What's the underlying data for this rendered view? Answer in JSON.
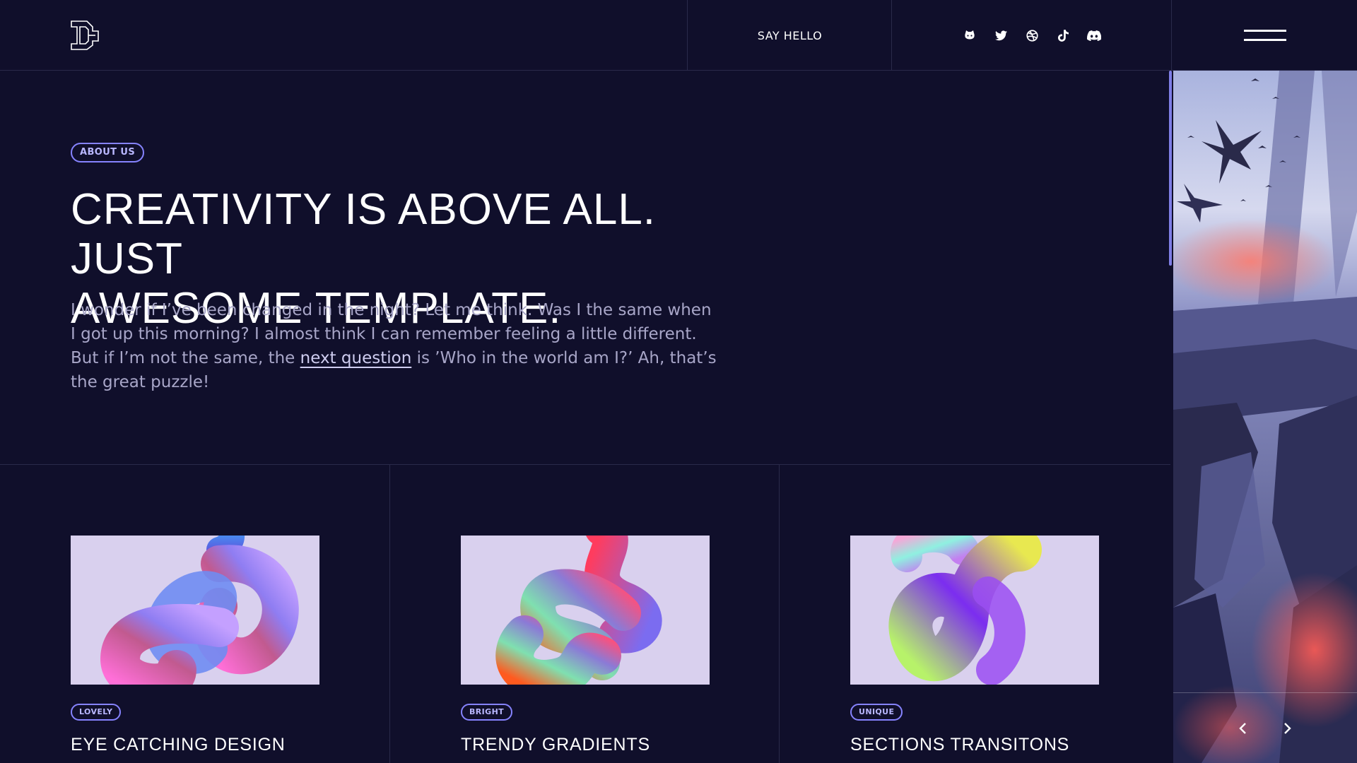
{
  "header": {
    "logo_icon": "logo-icon",
    "say_hello_label": "SAY HELLO",
    "socials": [
      "github-icon",
      "twitter-icon",
      "dribbble-icon",
      "tiktok-icon",
      "discord-icon"
    ],
    "menu_icon": "hamburger-menu-icon"
  },
  "hero": {
    "badge": "ABOUT US",
    "title_line1": "CREATIVITY IS ABOVE ALL. JUST",
    "title_line2": "AWESOME TEMPLATE.",
    "text_before_link": "I wonder if I’ve been changed in the night? Let me think. Was I the same when I got up this morning? I almost think I can remember feeling a little different. But if I’m not the same, the ",
    "link_text": "next question",
    "text_after_link": " is ’Who in the world am I?’ Ah, that’s the great puzzle!"
  },
  "cards": [
    {
      "badge": "LOVELY",
      "title": "EYE CATCHING DESIGN"
    },
    {
      "badge": "BRIGHT",
      "title": "TRENDY GRADIENTS"
    },
    {
      "badge": "UNIQUE",
      "title": "SECTIONS TRANSITONS"
    }
  ],
  "side_panel": {
    "image": "fantasy-dragon-landscape",
    "prev_icon": "chevron-left-icon",
    "next_icon": "chevron-right-icon"
  },
  "colors": {
    "background": "#100f2b",
    "accent": "#8683ff",
    "text_muted": "#a8a6c8",
    "card_bg": "#d9d0ee"
  }
}
